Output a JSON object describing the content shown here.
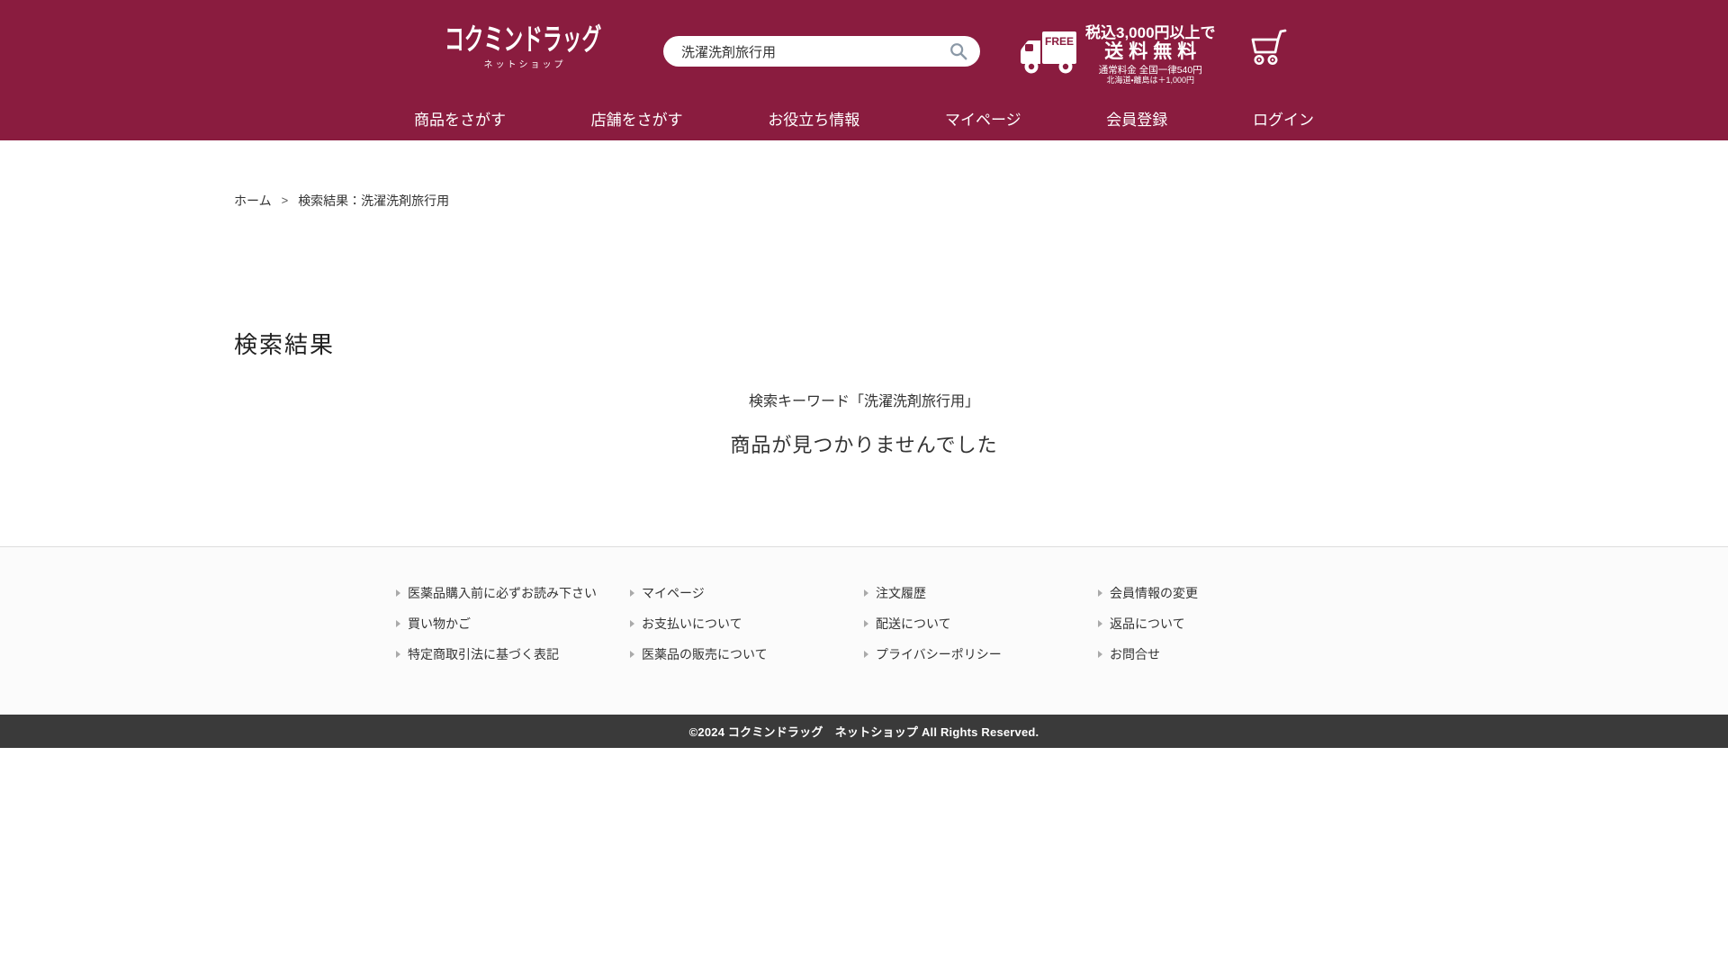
{
  "colors": {
    "brand": "#8a1c3f",
    "copyright_bar": "#3a3a3a",
    "footer_bg": "#fbfbfb"
  },
  "brand": {
    "logo_text": "コクミンドラッグ",
    "logo_sub": "ネットショップ"
  },
  "header": {
    "search": {
      "value": "洗濯洗剤旅行用"
    },
    "shipping": {
      "truck_badge": "FREE",
      "line1": "税込3,000円以上で",
      "line2": "送料無料",
      "line3": "通常料金 全国一律540円",
      "line4": "北海道・離島は＋1,000円"
    },
    "nav": [
      {
        "label": "商品をさがす"
      },
      {
        "label": "店舗をさがす"
      },
      {
        "label": "お役立ち情報"
      },
      {
        "label": "マイページ"
      },
      {
        "label": "会員登録"
      },
      {
        "label": "ログイン"
      }
    ]
  },
  "breadcrumb": {
    "home": "ホーム",
    "separator": ">",
    "current": "検索結果：洗濯洗剤旅行用"
  },
  "main": {
    "title": "検索結果",
    "keyword_line": "検索キーワード「洗濯洗剤旅行用」",
    "no_results": "商品が見つかりませんでした"
  },
  "footer": {
    "columns": [
      {
        "links": [
          "医薬品購入前に必ずお読み下さい",
          "買い物かご",
          "特定商取引法に基づく表記"
        ]
      },
      {
        "links": [
          "マイページ",
          "お支払いについて",
          "医薬品の販売について"
        ]
      },
      {
        "links": [
          "注文履歴",
          "配送について",
          "プライバシーポリシー"
        ]
      },
      {
        "links": [
          "会員情報の変更",
          "返品について",
          "お問合せ"
        ]
      }
    ],
    "copyright": "©2024 コクミンドラッグ　ネットショップ All Rights Reserved."
  }
}
